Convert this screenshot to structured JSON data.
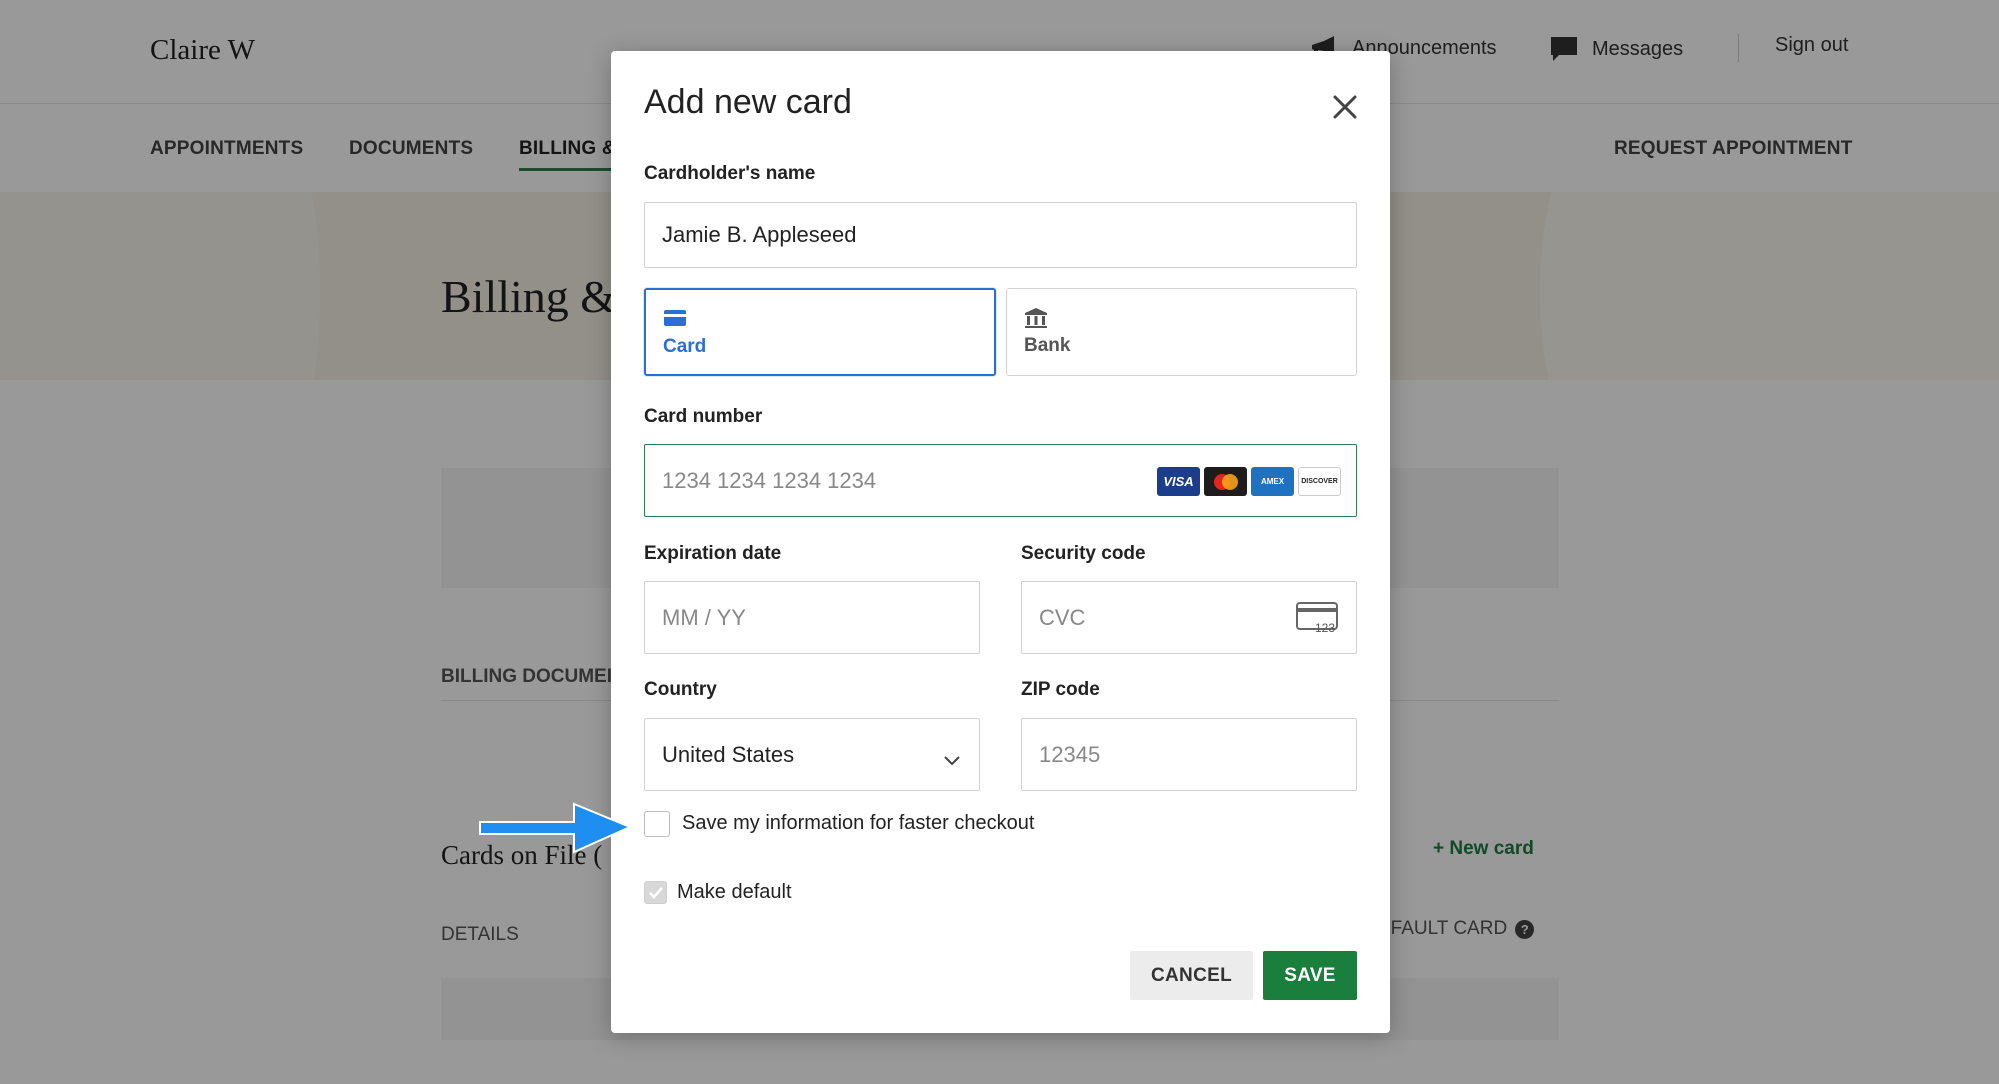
{
  "app": {
    "user_name": "Claire W",
    "top_links": {
      "announcements": "Announcements",
      "messages": "Messages",
      "sign_out": "Sign out"
    },
    "nav": {
      "appointments": "APPOINTMENTS",
      "documents": "DOCUMENTS",
      "billing": "BILLING &",
      "request": "REQUEST APPOINTMENT"
    },
    "page_title": "Billing &",
    "billing_documents": "BILLING DOCUMEI",
    "cards_on_file": "Cards on File (",
    "new_card": "+ New card",
    "details_header": "DETAILS",
    "default_card_header": "EFAULT CARD"
  },
  "modal": {
    "title": "Add new card",
    "cardholder_label": "Cardholder's name",
    "cardholder_value": "Jamie B. Appleseed",
    "tabs": [
      {
        "label": "Card",
        "icon": "credit-card-icon",
        "active": true
      },
      {
        "label": "Bank",
        "icon": "bank-icon",
        "active": false
      }
    ],
    "card_number_label": "Card number",
    "card_number_placeholder": "1234 1234 1234 1234",
    "card_brands": [
      "VISA",
      "Mastercard",
      "AMEX",
      "DISCOVER"
    ],
    "expiration_label": "Expiration date",
    "expiration_placeholder": "MM / YY",
    "security_label": "Security code",
    "security_placeholder": "CVC",
    "cvc_icon_text": "123",
    "country_label": "Country",
    "country_value": "United States",
    "zip_label": "ZIP code",
    "zip_placeholder": "12345",
    "save_info_label": "Save my information for faster checkout",
    "save_info_checked": false,
    "make_default_label": "Make default",
    "make_default_checked": true,
    "cancel_label": "CANCEL",
    "save_label": "SAVE"
  },
  "colors": {
    "accent_blue": "#2a6fd3",
    "brand_green": "#1a7f3c",
    "arrow_blue": "#1e8ff0"
  }
}
